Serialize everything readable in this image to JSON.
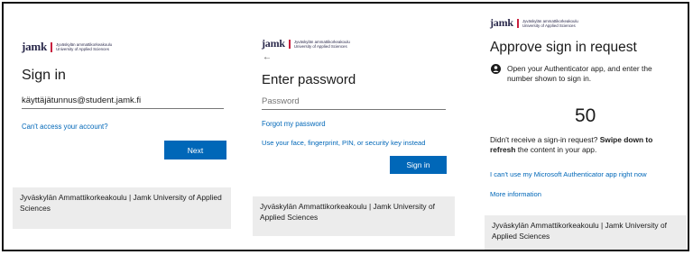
{
  "brand": {
    "word": "jamk",
    "subtitle_line1": "Jyväskylän ammattikorkeakoulu",
    "subtitle_line2": "University of Applied Sciences"
  },
  "signin": {
    "title": "Sign in",
    "username_value": "käyttäjätunnus@student.jamk.fi",
    "cant_access_link": "Can't access your account?",
    "next_button": "Next"
  },
  "password": {
    "back_arrow": "←",
    "title": "Enter password",
    "password_placeholder": "Password",
    "forgot_link": "Forgot my password",
    "alt_method_link": "Use your face, fingerprint, PIN, or security key instead",
    "signin_button": "Sign in"
  },
  "approve": {
    "title": "Approve sign in request",
    "instruction": "Open your Authenticator app, and enter the number shown to sign in.",
    "number": "50",
    "didnt_receive_prefix": "Didn't receive a sign-in request?",
    "swipe_bold": "Swipe down to refresh",
    "swipe_suffix": "the content in your app.",
    "cant_use_link": "I can't use my Microsoft Authenticator app right now",
    "more_info_link": "More information"
  },
  "footer_text": "Jyväskylän Ammattikorkeakoulu | Jamk University of Applied Sciences",
  "colors": {
    "accent": "#0067b8",
    "brand_navy": "#2b2a4c",
    "brand_red": "#c8203f",
    "footer_bg": "#ececec"
  }
}
